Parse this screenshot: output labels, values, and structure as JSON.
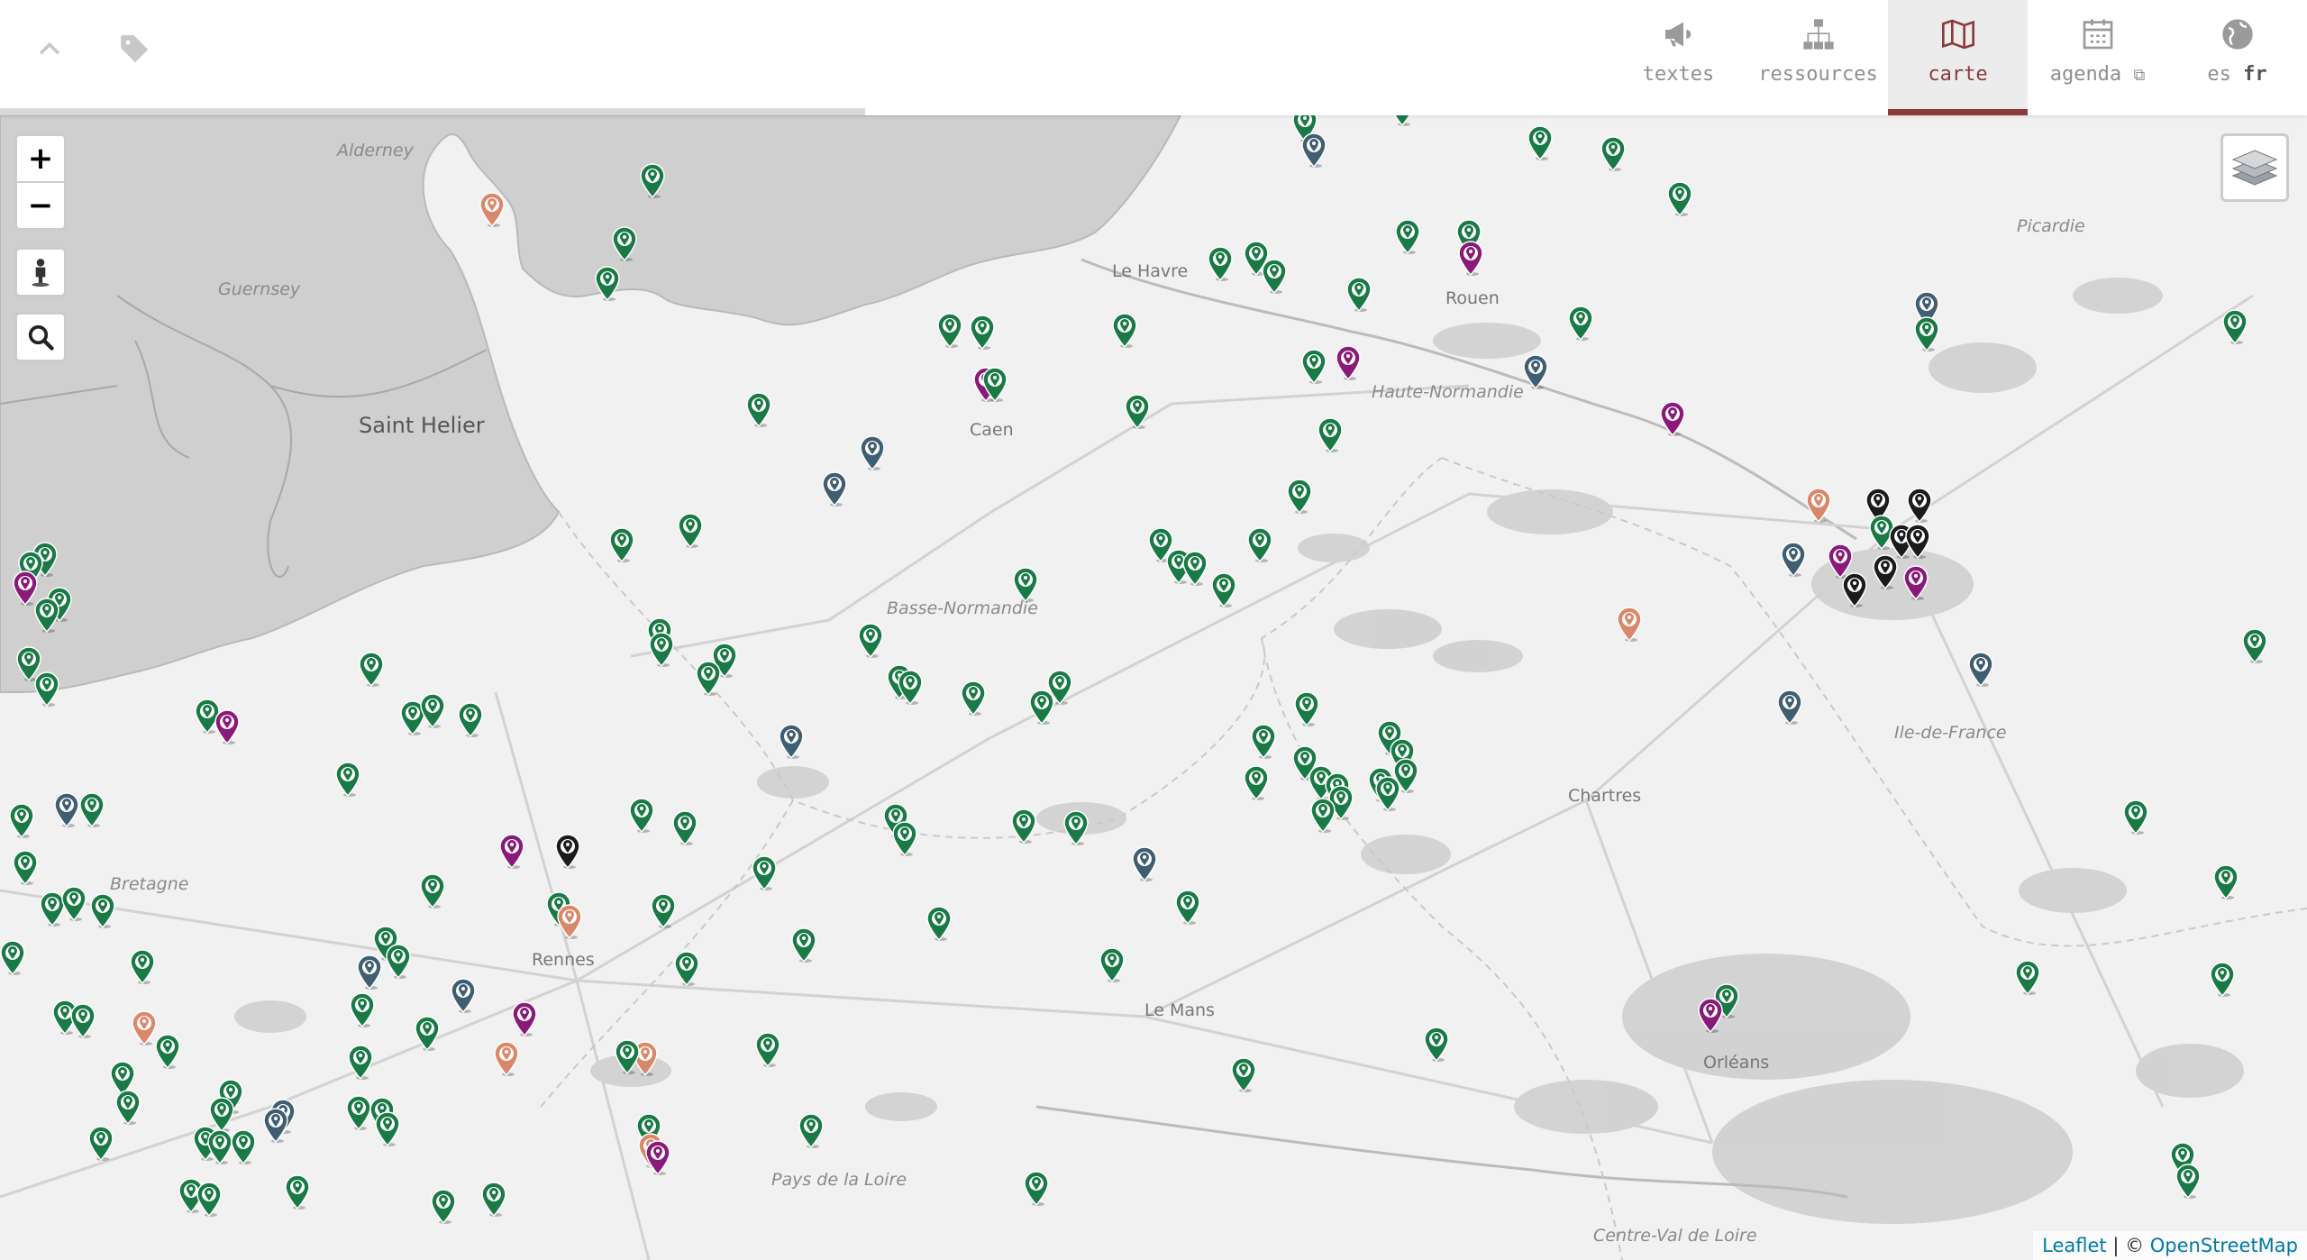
{
  "header": {
    "icons": [
      "chevron-up-icon",
      "tag-icon"
    ],
    "nav": [
      {
        "label": "textes",
        "icon": "megaphone-icon"
      },
      {
        "label": "ressources",
        "icon": "sitemap-icon"
      },
      {
        "label": "carte",
        "icon": "map-icon",
        "active": true
      },
      {
        "label": "agenda",
        "icon": "calendar-icon",
        "suffix_icon": "external-link-icon"
      },
      {
        "lang": [
          "es",
          "fr"
        ],
        "current": "fr",
        "icon": "globe-icon"
      }
    ]
  },
  "map": {
    "controls": {
      "zoom_in": "+",
      "zoom_out": "−",
      "pegman": "pegman-icon",
      "search": "search-icon",
      "layers": "layers-icon"
    },
    "places": [
      {
        "name": "Alderney",
        "style": "italic"
      },
      {
        "name": "Guernsey",
        "style": "italic"
      },
      {
        "name": "Saint Helier",
        "style": "big"
      },
      {
        "name": "Le Havre",
        "style": "normal"
      },
      {
        "name": "Rouen",
        "style": "normal"
      },
      {
        "name": "Caen",
        "style": "normal"
      },
      {
        "name": "Haute-Normandie",
        "style": "italic"
      },
      {
        "name": "Picardie",
        "style": "italic"
      },
      {
        "name": "Basse-Normandie",
        "style": "italic"
      },
      {
        "name": "Ile-de-France",
        "style": "italic"
      },
      {
        "name": "Chartres",
        "style": "normal"
      },
      {
        "name": "Bretagne",
        "style": "italic"
      },
      {
        "name": "Rennes",
        "style": "normal"
      },
      {
        "name": "Le Mans",
        "style": "normal"
      },
      {
        "name": "Orléans",
        "style": "normal"
      },
      {
        "name": "Pays de la Loire",
        "style": "italic"
      },
      {
        "name": "Centre-Val de Loire",
        "style": "italic"
      }
    ],
    "marker_colors": {
      "green": "#1a7a45",
      "purple": "#8a1a7a",
      "orange": "#d9896b",
      "slate": "#3f5e72",
      "black": "#1b1b1b"
    },
    "markers": [
      [
        "green",
        1448,
        158
      ],
      [
        "slate",
        1458,
        186
      ],
      [
        "green",
        1556,
        140
      ],
      [
        "green",
        1709,
        178
      ],
      [
        "green",
        1790,
        190
      ],
      [
        "green",
        1864,
        240
      ],
      [
        "green",
        724,
        220
      ],
      [
        "orange",
        546,
        252
      ],
      [
        "green",
        693,
        290
      ],
      [
        "green",
        674,
        334
      ],
      [
        "green",
        1562,
        282
      ],
      [
        "green",
        1630,
        282
      ],
      [
        "purple",
        1632,
        306
      ],
      [
        "green",
        1354,
        312
      ],
      [
        "green",
        1394,
        306
      ],
      [
        "green",
        1414,
        326
      ],
      [
        "green",
        1508,
        346
      ],
      [
        "green",
        1754,
        378
      ],
      [
        "slate",
        2138,
        362
      ],
      [
        "green",
        2138,
        390
      ],
      [
        "green",
        2480,
        382
      ],
      [
        "green",
        1054,
        386
      ],
      [
        "green",
        1090,
        388
      ],
      [
        "green",
        1248,
        386
      ],
      [
        "green",
        1458,
        426
      ],
      [
        "purple",
        1496,
        422
      ],
      [
        "slate",
        1704,
        432
      ],
      [
        "purple",
        1856,
        484
      ],
      [
        "purple",
        1094,
        446
      ],
      [
        "green",
        1104,
        446
      ],
      [
        "green",
        842,
        474
      ],
      [
        "green",
        1262,
        476
      ],
      [
        "slate",
        968,
        522
      ],
      [
        "slate",
        926,
        562
      ],
      [
        "green",
        1476,
        502
      ],
      [
        "green",
        1442,
        570
      ],
      [
        "orange",
        2018,
        580
      ],
      [
        "black",
        2084,
        580
      ],
      [
        "black",
        2130,
        580
      ],
      [
        "green",
        2088,
        610
      ],
      [
        "black",
        2110,
        620
      ],
      [
        "black",
        2128,
        620
      ],
      [
        "slate",
        1990,
        640
      ],
      [
        "purple",
        2042,
        642
      ],
      [
        "black",
        2092,
        654
      ],
      [
        "black",
        2058,
        674
      ],
      [
        "purple",
        2126,
        666
      ],
      [
        "orange",
        1808,
        712
      ],
      [
        "slate",
        2198,
        762
      ],
      [
        "green",
        2502,
        736
      ],
      [
        "slate",
        1986,
        804
      ],
      [
        "green",
        1288,
        624
      ],
      [
        "green",
        1308,
        648
      ],
      [
        "green",
        1326,
        650
      ],
      [
        "green",
        1358,
        674
      ],
      [
        "green",
        1398,
        624
      ],
      [
        "green",
        1138,
        668
      ],
      [
        "green",
        690,
        624
      ],
      [
        "green",
        766,
        608
      ],
      [
        "green",
        50,
        640
      ],
      [
        "green",
        34,
        650
      ],
      [
        "purple",
        28,
        672
      ],
      [
        "green",
        66,
        690
      ],
      [
        "green",
        52,
        702
      ],
      [
        "green",
        32,
        756
      ],
      [
        "green",
        52,
        784
      ],
      [
        "green",
        732,
        724
      ],
      [
        "green",
        734,
        740
      ],
      [
        "green",
        966,
        730
      ],
      [
        "green",
        804,
        752
      ],
      [
        "green",
        786,
        772
      ],
      [
        "green",
        412,
        762
      ],
      [
        "green",
        230,
        814
      ],
      [
        "purple",
        252,
        826
      ],
      [
        "green",
        458,
        816
      ],
      [
        "green",
        480,
        808
      ],
      [
        "green",
        522,
        818
      ],
      [
        "green",
        998,
        776
      ],
      [
        "green",
        1010,
        782
      ],
      [
        "green",
        1080,
        794
      ],
      [
        "green",
        1176,
        782
      ],
      [
        "green",
        1156,
        804
      ],
      [
        "slate",
        878,
        842
      ],
      [
        "green",
        386,
        884
      ],
      [
        "green",
        1450,
        806
      ],
      [
        "green",
        1402,
        842
      ],
      [
        "green",
        1448,
        866
      ],
      [
        "green",
        1542,
        838
      ],
      [
        "green",
        1556,
        858
      ],
      [
        "green",
        1560,
        880
      ],
      [
        "green",
        1532,
        890
      ],
      [
        "green",
        1394,
        888
      ],
      [
        "green",
        1466,
        888
      ],
      [
        "green",
        1484,
        896
      ],
      [
        "green",
        1488,
        910
      ],
      [
        "green",
        1468,
        924
      ],
      [
        "green",
        1540,
        900
      ],
      [
        "green",
        24,
        930
      ],
      [
        "slate",
        74,
        918
      ],
      [
        "green",
        102,
        918
      ],
      [
        "green",
        28,
        982
      ],
      [
        "green",
        712,
        924
      ],
      [
        "green",
        760,
        938
      ],
      [
        "green",
        994,
        930
      ],
      [
        "green",
        1004,
        950
      ],
      [
        "purple",
        568,
        964
      ],
      [
        "black",
        630,
        964
      ],
      [
        "green",
        1136,
        936
      ],
      [
        "green",
        1194,
        938
      ],
      [
        "slate",
        1270,
        978
      ],
      [
        "green",
        480,
        1008
      ],
      [
        "green",
        58,
        1028
      ],
      [
        "green",
        82,
        1022
      ],
      [
        "green",
        114,
        1030
      ],
      [
        "green",
        848,
        988
      ],
      [
        "green",
        620,
        1028
      ],
      [
        "orange",
        632,
        1042
      ],
      [
        "green",
        736,
        1030
      ],
      [
        "green",
        1042,
        1044
      ],
      [
        "green",
        1318,
        1026
      ],
      [
        "green",
        14,
        1082
      ],
      [
        "green",
        158,
        1092
      ],
      [
        "green",
        428,
        1066
      ],
      [
        "green",
        442,
        1086
      ],
      [
        "slate",
        410,
        1098
      ],
      [
        "green",
        892,
        1068
      ],
      [
        "green",
        762,
        1094
      ],
      [
        "green",
        1234,
        1090
      ],
      [
        "slate",
        514,
        1124
      ],
      [
        "purple",
        582,
        1150
      ],
      [
        "green",
        72,
        1148
      ],
      [
        "green",
        92,
        1152
      ],
      [
        "orange",
        160,
        1160
      ],
      [
        "green",
        186,
        1186
      ],
      [
        "green",
        402,
        1140
      ],
      [
        "green",
        474,
        1166
      ],
      [
        "green",
        400,
        1198
      ],
      [
        "orange",
        562,
        1194
      ],
      [
        "orange",
        716,
        1194
      ],
      [
        "green",
        696,
        1192
      ],
      [
        "green",
        852,
        1184
      ],
      [
        "green",
        1594,
        1178
      ],
      [
        "green",
        1380,
        1212
      ],
      [
        "green",
        1916,
        1130
      ],
      [
        "purple",
        1898,
        1146
      ],
      [
        "green",
        2250,
        1104
      ],
      [
        "green",
        2466,
        1106
      ],
      [
        "green",
        2470,
        998
      ],
      [
        "green",
        2370,
        926
      ],
      [
        "green",
        136,
        1216
      ],
      [
        "green",
        142,
        1248
      ],
      [
        "green",
        256,
        1236
      ],
      [
        "green",
        246,
        1256
      ],
      [
        "slate",
        314,
        1258
      ],
      [
        "slate",
        306,
        1268
      ],
      [
        "green",
        398,
        1254
      ],
      [
        "green",
        424,
        1256
      ],
      [
        "green",
        430,
        1272
      ],
      [
        "green",
        228,
        1288
      ],
      [
        "green",
        244,
        1292
      ],
      [
        "green",
        270,
        1292
      ],
      [
        "green",
        112,
        1288
      ],
      [
        "green",
        900,
        1274
      ],
      [
        "green",
        720,
        1274
      ],
      [
        "orange",
        722,
        1296
      ],
      [
        "purple",
        730,
        1304
      ],
      [
        "green",
        1150,
        1338
      ],
      [
        "green",
        2422,
        1306
      ],
      [
        "green",
        2428,
        1330
      ],
      [
        "green",
        212,
        1346
      ],
      [
        "green",
        232,
        1350
      ],
      [
        "green",
        330,
        1342
      ],
      [
        "green",
        492,
        1358
      ],
      [
        "green",
        548,
        1350
      ]
    ]
  },
  "attribution": {
    "leaflet": "Leaflet",
    "separator": " | © ",
    "osm": "OpenStreetMap"
  }
}
